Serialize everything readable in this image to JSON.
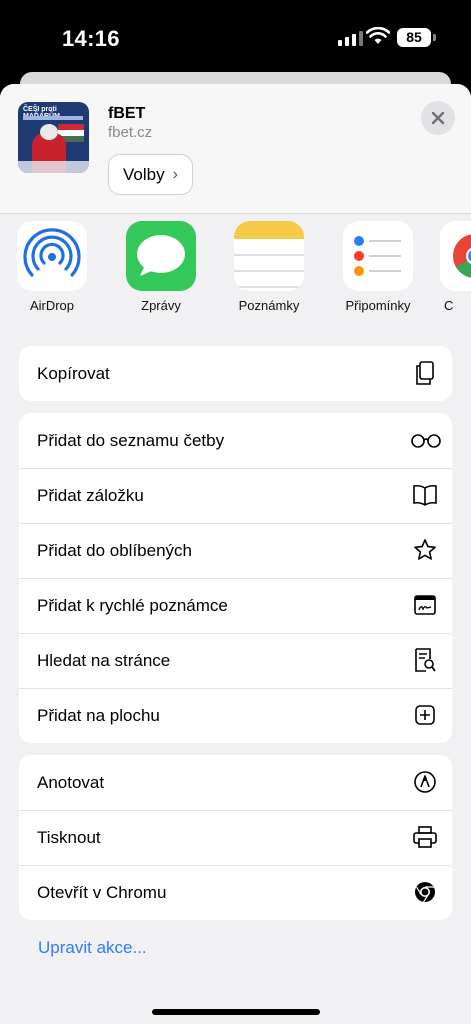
{
  "status": {
    "time": "14:16",
    "battery": "85"
  },
  "share": {
    "title": "fBET",
    "url": "fbet.cz",
    "thumbnail_text": "ČEŠI proti MAĎARŮM",
    "options_label": "Volby"
  },
  "apps": [
    {
      "label": "AirDrop",
      "icon": "airdrop-icon"
    },
    {
      "label": "Zprávy",
      "icon": "messages-icon"
    },
    {
      "label": "Poznámky",
      "icon": "notes-icon"
    },
    {
      "label": "Připomínky",
      "icon": "reminders-icon"
    },
    {
      "label": "C",
      "icon": "chrome-icon"
    }
  ],
  "actions": {
    "group1": [
      {
        "label": "Kopírovat",
        "icon": "copy-icon"
      }
    ],
    "group2": [
      {
        "label": "Přidat do seznamu četby",
        "icon": "glasses-icon"
      },
      {
        "label": "Přidat záložku",
        "icon": "book-icon"
      },
      {
        "label": "Přidat do oblíbených",
        "icon": "star-icon"
      },
      {
        "label": "Přidat k rychlé poznámce",
        "icon": "quick-note-icon"
      },
      {
        "label": "Hledat na stránce",
        "icon": "find-on-page-icon"
      },
      {
        "label": "Přidat na plochu",
        "icon": "add-square-icon"
      }
    ],
    "group3": [
      {
        "label": "Anotovat",
        "icon": "markup-icon"
      },
      {
        "label": "Tisknout",
        "icon": "printer-icon"
      },
      {
        "label": "Otevřít v Chromu",
        "icon": "chrome-small-icon"
      }
    ]
  },
  "edit_actions_label": "Upravit akce...",
  "colors": {
    "accent": "#2f7cf6",
    "sheet_bg": "#f1f1f3",
    "messages_green": "#34c759",
    "notes_yellow": "#f7c948"
  }
}
